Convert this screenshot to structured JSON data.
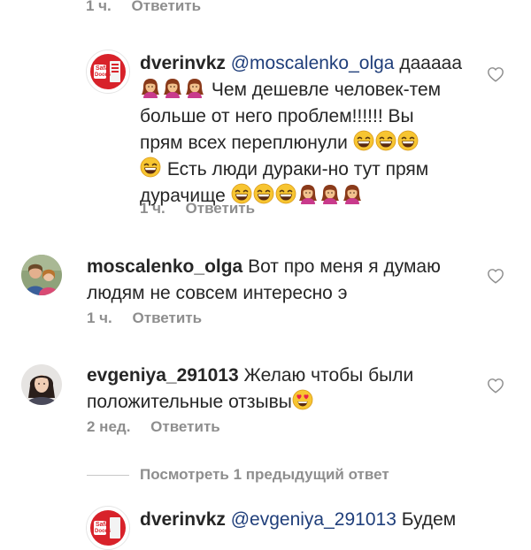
{
  "comments": [
    {
      "time": "1 ч.",
      "reply": "Ответить"
    },
    {
      "username": "dverinvkz",
      "mention": "@moscalenko_olga",
      "line1_after": "дааааа",
      "line2": "Чем дешевле человек-тем",
      "line3": "больше от него проблем!!!!!! Вы",
      "line4": "прям всех переплюнули",
      "line5": "Есть люди дураки-но тут прям",
      "line6": "дурачище",
      "avatar_text_top": "Safa",
      "avatar_text_bottom": "DoorS",
      "time": "1 ч.",
      "reply": "Ответить"
    },
    {
      "username": "moscalenko_olga",
      "line1": "Вот про меня я думаю",
      "line2": "людям не совсем интересно э",
      "time": "1 ч.",
      "reply": "Ответить"
    },
    {
      "username": "evgeniya_291013",
      "line1": "Желаю чтобы были",
      "line2": "положительные отзывы",
      "time": "2 нед.",
      "reply": "Ответить"
    }
  ],
  "view_more": "Посмотреть 1 предыдущий ответ",
  "last_reply": {
    "username": "dverinvkz",
    "mention": "@evgeniya_291013",
    "text": "Будем",
    "avatar_text_top": "Safa",
    "avatar_text_bottom": "DoorS"
  },
  "icons": [
    "heart-outline-icon",
    "woman-emoji-icon",
    "laughing-emoji-icon",
    "heart-eyes-emoji-icon"
  ]
}
